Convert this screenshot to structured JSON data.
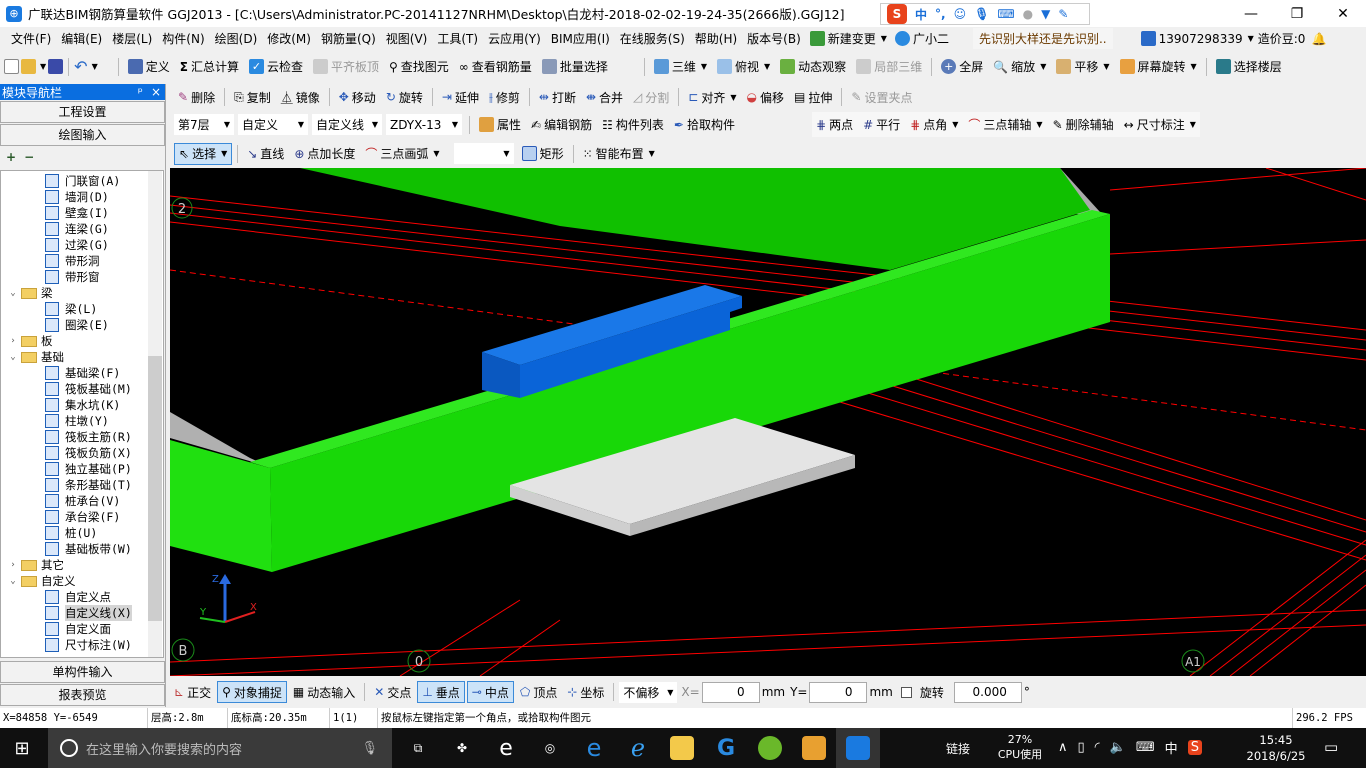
{
  "title": {
    "text": "广联达BIM钢筋算量软件 GGJ2013 - [C:\\Users\\Administrator.PC-20141127NRHM\\Desktop\\白龙村-2018-02-02-19-24-35(2666版).GGJ12]",
    "minimize": "—",
    "restore": "❐",
    "close": "✕"
  },
  "ime": {
    "brand": "S",
    "mode": "中",
    "punct": "°,",
    "icons": [
      "emoji-icon",
      "mic-icon",
      "keyboard-icon",
      "user-icon",
      "skin-icon",
      "wrench-icon"
    ]
  },
  "menu": [
    "文件(F)",
    "编辑(E)",
    "楼层(L)",
    "构件(N)",
    "绘图(D)",
    "修改(M)",
    "钢筋量(Q)",
    "视图(V)",
    "工具(T)",
    "云应用(Y)",
    "BIM应用(I)",
    "在线服务(S)",
    "帮助(H)",
    "版本号(B)"
  ],
  "menu_extra": {
    "new_change": "新建变更",
    "assistant": "广小二",
    "tip": "先识别大样还是先识别..",
    "phone": "13907298339",
    "beans": "造价豆:0"
  },
  "toolbar1": {
    "left": [
      "定义",
      "汇总计算",
      "云检查",
      "平齐板顶",
      "查找图元",
      "查看钢筋量",
      "批量选择"
    ],
    "right": [
      "三维",
      "俯视",
      "动态观察",
      "局部三维",
      "全屏",
      "缩放",
      "平移",
      "屏幕旋转",
      "选择楼层"
    ]
  },
  "nav": {
    "title": "模块导航栏",
    "pin": "ᵖ",
    "close": "×",
    "project_settings": "工程设置",
    "drawing_input": "绘图输入",
    "single_input": "单构件输入",
    "report_preview": "报表预览",
    "expand": "+",
    "collapse": "−"
  },
  "tree": [
    {
      "lvl": 2,
      "label": "门联窗(A)"
    },
    {
      "lvl": 2,
      "label": "墙洞(D)"
    },
    {
      "lvl": 2,
      "label": "壁龛(I)"
    },
    {
      "lvl": 2,
      "label": "连梁(G)"
    },
    {
      "lvl": 2,
      "label": "过梁(G)"
    },
    {
      "lvl": 2,
      "label": "带形洞"
    },
    {
      "lvl": 2,
      "label": "带形窗"
    },
    {
      "lvl": 1,
      "label": "梁",
      "open": true
    },
    {
      "lvl": 2,
      "label": "梁(L)"
    },
    {
      "lvl": 2,
      "label": "圈梁(E)"
    },
    {
      "lvl": 1,
      "label": "板",
      "open": false
    },
    {
      "lvl": 1,
      "label": "基础",
      "open": true
    },
    {
      "lvl": 2,
      "label": "基础梁(F)"
    },
    {
      "lvl": 2,
      "label": "筏板基础(M)"
    },
    {
      "lvl": 2,
      "label": "集水坑(K)"
    },
    {
      "lvl": 2,
      "label": "柱墩(Y)"
    },
    {
      "lvl": 2,
      "label": "筏板主筋(R)"
    },
    {
      "lvl": 2,
      "label": "筏板负筋(X)"
    },
    {
      "lvl": 2,
      "label": "独立基础(P)"
    },
    {
      "lvl": 2,
      "label": "条形基础(T)"
    },
    {
      "lvl": 2,
      "label": "桩承台(V)"
    },
    {
      "lvl": 2,
      "label": "承台梁(F)"
    },
    {
      "lvl": 2,
      "label": "桩(U)"
    },
    {
      "lvl": 2,
      "label": "基础板带(W)"
    },
    {
      "lvl": 1,
      "label": "其它",
      "open": false
    },
    {
      "lvl": 1,
      "label": "自定义",
      "open": true
    },
    {
      "lvl": 2,
      "label": "自定义点"
    },
    {
      "lvl": 2,
      "label": "自定义线(X)",
      "selected": true
    },
    {
      "lvl": 2,
      "label": "自定义面"
    },
    {
      "lvl": 2,
      "label": "尺寸标注(W)"
    }
  ],
  "edit_toolbar": [
    "删除",
    "复制",
    "镜像",
    "移动",
    "旋转",
    "延伸",
    "修剪",
    "打断",
    "合并",
    "分割",
    "对齐",
    "偏移",
    "拉伸",
    "设置夹点"
  ],
  "props_toolbar": {
    "floor": "第7层",
    "type": "自定义",
    "subtype": "自定义线",
    "component": "ZDYX-13",
    "items": [
      "属性",
      "编辑钢筋",
      "构件列表",
      "拾取构件"
    ]
  },
  "axis_toolbar": [
    "两点",
    "平行",
    "点角",
    "三点辅轴",
    "删除辅轴",
    "尺寸标注"
  ],
  "draw_toolbar": {
    "select": "选择",
    "items": [
      "直线",
      "点加长度",
      "三点画弧"
    ],
    "combo": "",
    "rect": "矩形",
    "smart": "智能布置"
  },
  "viewport": {
    "axis_labels": [
      "2",
      "B",
      "0",
      "A1"
    ],
    "colors": {
      "beam": "#1fd20f",
      "block": "#0a64d8",
      "slab": "#e4e4e4",
      "grid": "#ff0000"
    }
  },
  "snapbar": {
    "ortho": "正交",
    "snap": "对象捕捉",
    "dynamic": "动态输入",
    "intersect": "交点",
    "perp": "垂点",
    "mid": "中点",
    "vertex": "顶点",
    "coord": "坐标",
    "offset": "不偏移",
    "x_label": "X=",
    "x": "0",
    "mm1": "mm",
    "y_label": "Y=",
    "y": "0",
    "mm2": "mm",
    "rotate": "旋转",
    "angle": "0.000",
    "deg": "°"
  },
  "status": {
    "coords": "X=84858 Y=-6549",
    "floor_height": "层高:2.8m",
    "base_height": "底标高:20.35m",
    "count": "1(1)",
    "hint": "按鼠标左键指定第一个角点，或拾取构件图元",
    "fps": "296.2 FPS"
  },
  "taskbar": {
    "search": "在这里输入你要搜索的内容",
    "link": "链接",
    "cpu": "27%",
    "cpu_label": "CPU使用",
    "ime": "中",
    "time": "15:45",
    "date": "2018/6/25"
  }
}
